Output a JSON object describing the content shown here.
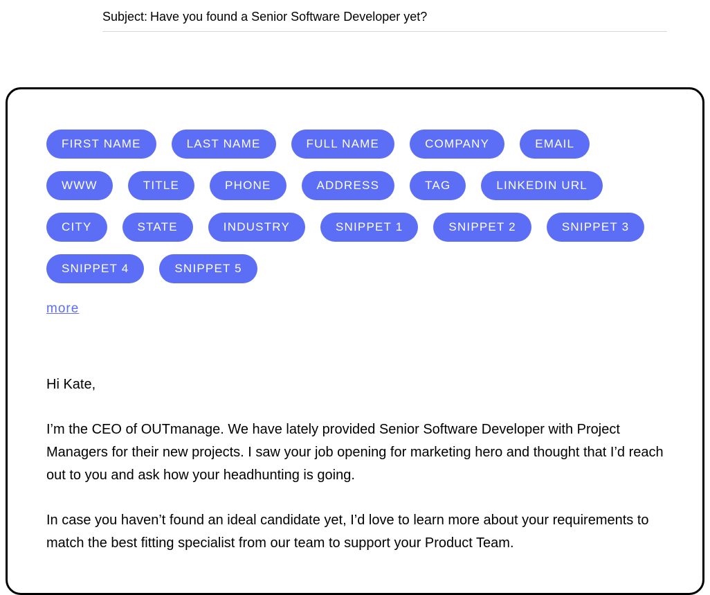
{
  "subject": {
    "label": "Subject:",
    "text": "Have you found a Senior Software Developer yet?"
  },
  "pills": [
    "FIRST NAME",
    "LAST NAME",
    "FULL NAME",
    "COMPANY",
    "EMAIL",
    "WWW",
    "TITLE",
    "PHONE",
    "ADDRESS",
    "TAG",
    "LINKEDIN URL",
    "CITY",
    "STATE",
    "INDUSTRY",
    "SNIPPET 1",
    "SNIPPET 2",
    "SNIPPET 3",
    "SNIPPET 4",
    "SNIPPET 5"
  ],
  "more_label": "more",
  "body": {
    "greeting": "Hi Kate,",
    "para1": "I’m the CEO of OUTmanage. We have lately provided Senior Software Developer with Project Managers for their new projects. I saw your job opening for marketing hero and thought that I’d reach out to you and ask how your headhunting is going.",
    "para2": "In case you haven’t found an ideal candidate yet, I’d love to learn more about your requirements to match the best fitting specialist from our team to support your Product Team."
  }
}
